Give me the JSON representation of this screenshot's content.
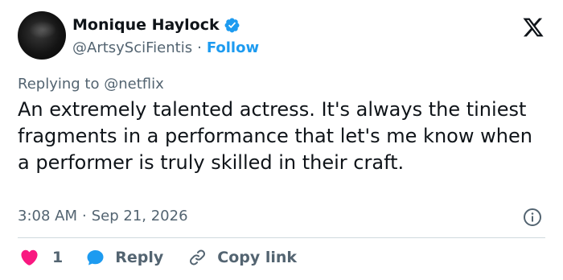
{
  "author": {
    "name": "Monique Haylock",
    "handle": "@ArtsySciFientis",
    "separator": "·",
    "follow_label": "Follow"
  },
  "tweet": {
    "reply_prefix": "Replying to",
    "reply_mention": "@netflix",
    "text": "An extremely talented actress. It's always the tiniest fragments in a performance that let's me know when a performer is truly skilled in their craft.",
    "time": "3:08 AM",
    "separator": "·",
    "date": "Sep 21, 2026"
  },
  "actions": {
    "like_count": "1",
    "reply_label": "Reply",
    "copy_link_label": "Copy link"
  },
  "icons": {
    "brand": "x-logo-icon",
    "verified": "verified-badge-icon",
    "info": "info-icon",
    "like": "heart-icon",
    "reply": "speech-bubble-icon",
    "copy": "link-icon"
  },
  "colors": {
    "accent": "#1d9bf0",
    "like": "#f91880",
    "text": "#0f1419",
    "muted": "#536471",
    "divider": "#cfd9de"
  }
}
